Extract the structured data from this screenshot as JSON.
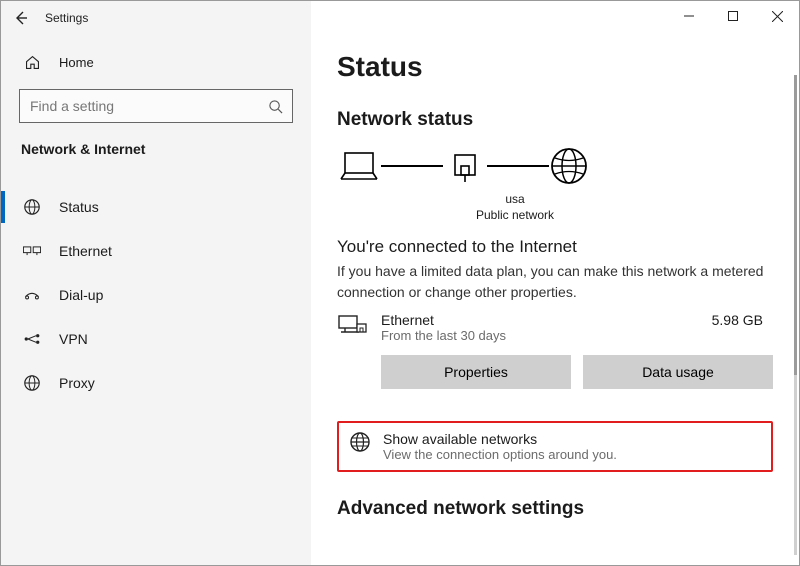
{
  "window": {
    "title": "Settings"
  },
  "sidebar": {
    "home_label": "Home",
    "search_placeholder": "Find a setting",
    "section_label": "Network & Internet",
    "items": [
      {
        "label": "Status",
        "icon": "status-icon",
        "active": true
      },
      {
        "label": "Ethernet",
        "icon": "ethernet-icon",
        "active": false
      },
      {
        "label": "Dial-up",
        "icon": "dialup-icon",
        "active": false
      },
      {
        "label": "VPN",
        "icon": "vpn-icon",
        "active": false
      },
      {
        "label": "Proxy",
        "icon": "proxy-icon",
        "active": false
      }
    ]
  },
  "main": {
    "title": "Status",
    "network_status_heading": "Network status",
    "diagram": {
      "device_label": "usa",
      "device_type": "Public network"
    },
    "connected_title": "You're connected to the Internet",
    "connected_sub": "If you have a limited data plan, you can make this network a metered connection or change other properties.",
    "adapter": {
      "name": "Ethernet",
      "subtitle": "From the last 30 days",
      "usage": "5.98 GB"
    },
    "buttons": {
      "properties": "Properties",
      "data_usage": "Data usage"
    },
    "show_networks": {
      "title": "Show available networks",
      "subtitle": "View the connection options around you."
    },
    "advanced_heading": "Advanced network settings"
  }
}
